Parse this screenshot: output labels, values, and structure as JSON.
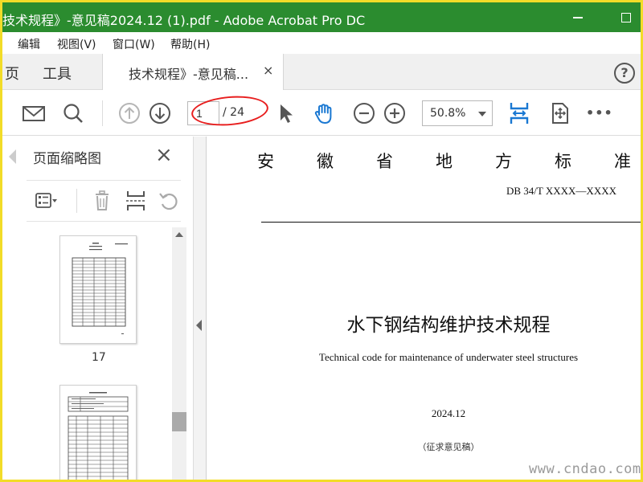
{
  "window": {
    "title": "技术规程》-意见稿2024.12 (1).pdf - Adobe Acrobat Pro DC",
    "accent": "#2b8c2f",
    "border": "#f2dc28"
  },
  "menu": [
    "编辑",
    "视图(V)",
    "窗口(W)",
    "帮助(H)"
  ],
  "tabs": {
    "home": "页",
    "tools": "工具",
    "doc": "技术规程》-意见稿...",
    "close": "×"
  },
  "toolbar": {
    "page_current": "1",
    "page_total": "/ 24",
    "zoom": "50.8%",
    "more": "•••",
    "highlight": "#e81e1e"
  },
  "sidebar": {
    "title": "页面缩略图",
    "close": "×",
    "thumbnail_label": "17"
  },
  "document": {
    "header_chars": [
      "安",
      "徽",
      "省",
      "地",
      "方",
      "标",
      "准"
    ],
    "standard_no": "DB 34/T  XXXX—XXXX",
    "title_cn": "水下钢结构维护技术规程",
    "title_en": "Technical code for maintenance of underwater steel structures",
    "date": "2024.12",
    "status": "（征求意见稿）"
  },
  "watermark": "www.cndao.com"
}
